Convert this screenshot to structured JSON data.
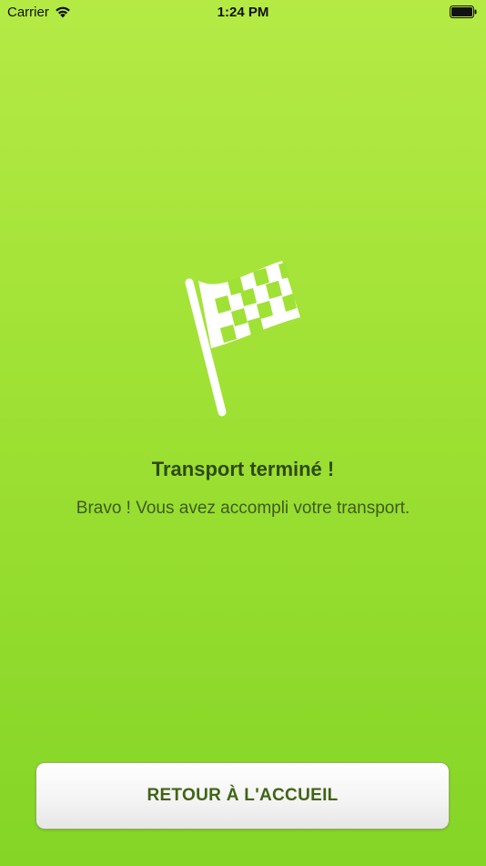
{
  "status_bar": {
    "carrier": "Carrier",
    "time": "1:24 PM",
    "wifi_icon": "wifi-icon",
    "battery_icon": "battery-icon"
  },
  "main": {
    "icon": "checkered-flag-icon",
    "title": "Transport terminé !",
    "message": "Bravo ! Vous avez accompli votre transport."
  },
  "actions": {
    "home_label": "RETOUR À L'ACCUEIL"
  },
  "colors": {
    "background_top": "#b5ea45",
    "background_bottom": "#84d526",
    "title": "#2e4a10",
    "button_text": "#3f6514"
  }
}
